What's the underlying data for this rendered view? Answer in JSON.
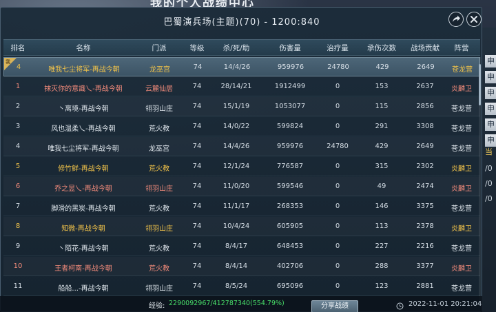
{
  "background": {
    "title": "我的个人战绩中心"
  },
  "window": {
    "title": "巴蜀演兵场(主题)(70) - 1200:840"
  },
  "icons": {
    "share": "share-icon",
    "close": "close-icon",
    "clock": "clock-icon",
    "self_badge": "self-marker-icon"
  },
  "colors": {
    "yellow_faction": "#f0c24a",
    "pink_faction": "#f08a7a",
    "exp_green": "#49e06a"
  },
  "table": {
    "headers": [
      "排名",
      "名称",
      "门派",
      "等级",
      "杀/死/助",
      "伤害量",
      "治疗量",
      "承伤次数",
      "战场贡献",
      "阵营"
    ],
    "self_row": {
      "rank": "4",
      "badge": "我",
      "name": "唯我七尘将军-再战今朝",
      "sect": "龙巫宫",
      "level": "74",
      "kda": "14/4/26",
      "damage": "959976",
      "heal": "24780",
      "hits": "429",
      "contribution": "2649",
      "faction": "苍龙营",
      "tone": "yellow"
    },
    "rows": [
      {
        "rank": "1",
        "name": "抹灭你的意識乀-再战今朝",
        "sect": "云麓仙居",
        "level": "74",
        "kda": "28/14/21",
        "damage": "1912499",
        "heal": "0",
        "hits": "153",
        "contribution": "2637",
        "faction": "炎麟卫",
        "tone": "pink"
      },
      {
        "rank": "2",
        "name": "丶离境-再战今朝",
        "sect": "翎羽山庄",
        "level": "74",
        "kda": "15/1/19",
        "damage": "1053077",
        "heal": "0",
        "hits": "115",
        "contribution": "2856",
        "faction": "苍龙营",
        "tone": "white"
      },
      {
        "rank": "3",
        "name": "风也温柔乀-再战今朝",
        "sect": "荒火教",
        "level": "74",
        "kda": "14/0/22",
        "damage": "599824",
        "heal": "0",
        "hits": "291",
        "contribution": "3308",
        "faction": "苍龙营",
        "tone": "white"
      },
      {
        "rank": "4",
        "name": "唯我七尘将军-再战今朝",
        "sect": "龙巫宫",
        "level": "74",
        "kda": "14/4/26",
        "damage": "959976",
        "heal": "24780",
        "hits": "429",
        "contribution": "2649",
        "faction": "苍龙营",
        "tone": "white"
      },
      {
        "rank": "5",
        "name": "修竹鲜-再战今朝",
        "sect": "荒火教",
        "level": "74",
        "kda": "12/1/24",
        "damage": "776587",
        "heal": "0",
        "hits": "315",
        "contribution": "2302",
        "faction": "炎麟卫",
        "tone": "yellow"
      },
      {
        "rank": "6",
        "name": "乔之昱乀-再战今朝",
        "sect": "翎羽山庄",
        "level": "74",
        "kda": "11/0/20",
        "damage": "599546",
        "heal": "0",
        "hits": "49",
        "contribution": "2474",
        "faction": "炎麟卫",
        "tone": "pink"
      },
      {
        "rank": "7",
        "name": "脚滑的黑炭-再战今朝",
        "sect": "荒火教",
        "level": "74",
        "kda": "11/1/17",
        "damage": "268353",
        "heal": "0",
        "hits": "146",
        "contribution": "3375",
        "faction": "苍龙营",
        "tone": "white"
      },
      {
        "rank": "8",
        "name": "知微-再战今朝",
        "sect": "翎羽山庄",
        "level": "74",
        "kda": "10/4/24",
        "damage": "605905",
        "heal": "0",
        "hits": "113",
        "contribution": "2378",
        "faction": "炎麟卫",
        "tone": "yellow"
      },
      {
        "rank": "9",
        "name": "丶陌花-再战今朝",
        "sect": "荒火教",
        "level": "74",
        "kda": "8/4/17",
        "damage": "648453",
        "heal": "0",
        "hits": "227",
        "contribution": "2216",
        "faction": "苍龙营",
        "tone": "white"
      },
      {
        "rank": "10",
        "name": "王者柯南-再战今朝",
        "sect": "荒火教",
        "level": "74",
        "kda": "8/4/14",
        "damage": "402706",
        "heal": "0",
        "hits": "288",
        "contribution": "3377",
        "faction": "炎麟卫",
        "tone": "pink"
      },
      {
        "rank": "11",
        "name": "船船...-再战今朝",
        "sect": "翎羽山庄",
        "level": "74",
        "kda": "8/5/24",
        "damage": "695096",
        "heal": "0",
        "hits": "123",
        "contribution": "2881",
        "faction": "苍龙营",
        "tone": "white"
      }
    ]
  },
  "footer": {
    "exp_label": "经验:",
    "exp_value": "2290092967/412787340(554.79%)",
    "action_button": "分享战绩",
    "time": "2022-11-01 20:21:04"
  },
  "right_sidebar": {
    "tab_glyph": "申",
    "slash_texts": [
      "/0",
      "/0",
      "/0"
    ],
    "gold_label": "当"
  }
}
